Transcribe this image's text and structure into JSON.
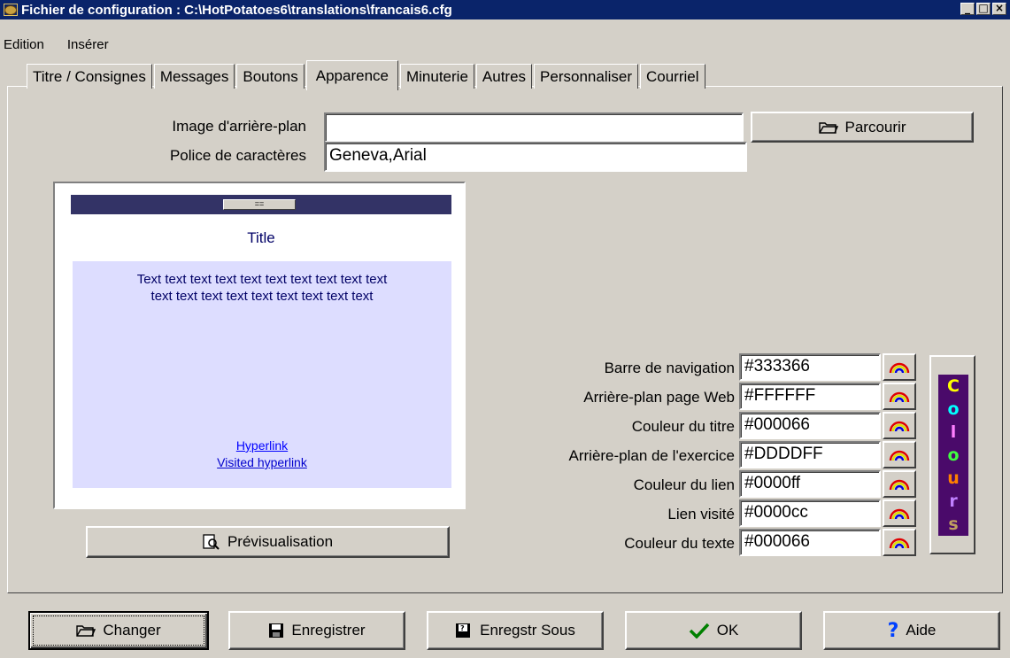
{
  "window": {
    "title": "Fichier de configuration : C:\\HotPotatoes6\\translations\\francais6.cfg",
    "buttons": {
      "minimize": "_",
      "maximize": "□",
      "close": "×"
    }
  },
  "menu": {
    "items": [
      "Edition",
      "Insérer"
    ]
  },
  "tabs": [
    {
      "label": "Titre / Consignes",
      "active": false
    },
    {
      "label": "Messages",
      "active": false
    },
    {
      "label": "Boutons",
      "active": false
    },
    {
      "label": "Apparence",
      "active": true
    },
    {
      "label": "Minuterie",
      "active": false
    },
    {
      "label": "Autres",
      "active": false
    },
    {
      "label": "Personnaliser",
      "active": false
    },
    {
      "label": "Courriel",
      "active": false
    }
  ],
  "appearance": {
    "background_image": {
      "label": "Image d'arrière-plan",
      "value": ""
    },
    "font": {
      "label": "Police de caractères",
      "value": "Geneva,Arial"
    },
    "browse_button": "Parcourir"
  },
  "preview": {
    "nav_button": "==",
    "title": "Title",
    "text_line1": "Text text text text text text text text text text",
    "text_line2": "text text text text text text text text text",
    "hyperlink": "Hyperlink",
    "visited_hyperlink": "Visited hyperlink",
    "button": "Prévisualisation"
  },
  "colors": [
    {
      "label": "Barre de navigation",
      "value": "#333366"
    },
    {
      "label": "Arrière-plan page Web",
      "value": "#FFFFFF"
    },
    {
      "label": "Couleur du titre",
      "value": "#000066"
    },
    {
      "label": "Arrière-plan de l'exercice",
      "value": "#DDDDFF"
    },
    {
      "label": "Couleur du lien",
      "value": "#0000ff"
    },
    {
      "label": "Lien visité",
      "value": "#0000cc"
    },
    {
      "label": "Couleur du texte",
      "value": "#000066"
    }
  ],
  "colours_panel": {
    "letters": [
      "C",
      "o",
      "l",
      "o",
      "u",
      "r",
      "s"
    ],
    "letter_colors": [
      "#ffff00",
      "#00ffff",
      "#ff80ff",
      "#40ff40",
      "#ff8000",
      "#c080ff",
      "#c0a060"
    ]
  },
  "bottom_buttons": {
    "change": "Changer",
    "save": "Enregistrer",
    "save_as": "Enregstr Sous",
    "ok": "OK",
    "help": "Aide"
  }
}
